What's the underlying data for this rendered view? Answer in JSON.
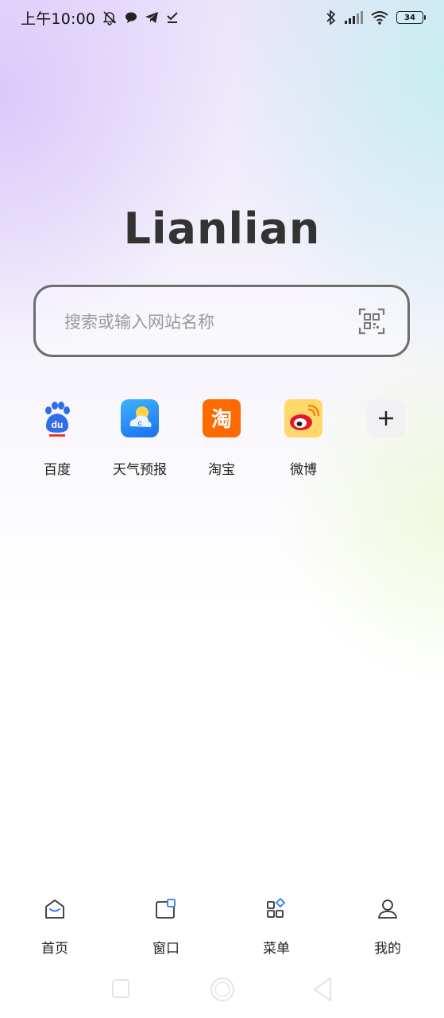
{
  "status_bar": {
    "time": "上午10:00",
    "battery": "34",
    "icons": [
      "bell-off-icon",
      "chat-bubble-icon",
      "telegram-icon",
      "download-check-icon",
      "bluetooth-icon",
      "signal-icon",
      "wifi-icon",
      "battery-icon"
    ]
  },
  "brand": {
    "title": "Lianlian"
  },
  "search": {
    "placeholder": "搜索或输入网站名称",
    "scan_icon": "qr-scan-icon"
  },
  "shortcuts": [
    {
      "label": "百度",
      "icon": "baidu-icon",
      "color": "#2932e1"
    },
    {
      "label": "天气预报",
      "icon": "weather-icon",
      "color": "#1e8cf0"
    },
    {
      "label": "淘宝",
      "icon": "taobao-icon",
      "color": "#ff6a00"
    },
    {
      "label": "微博",
      "icon": "weibo-icon",
      "color": "#e6162d"
    },
    {
      "label": "",
      "icon": "add-icon",
      "color": "#333333"
    }
  ],
  "bottom_nav": [
    {
      "label": "首页",
      "icon": "home-icon"
    },
    {
      "label": "窗口",
      "icon": "window-icon"
    },
    {
      "label": "菜单",
      "icon": "menu-grid-icon"
    },
    {
      "label": "我的",
      "icon": "profile-icon"
    }
  ],
  "colors": {
    "accent": "#2f7cf6",
    "text": "#222222",
    "search_border": "#6d6d6d"
  }
}
